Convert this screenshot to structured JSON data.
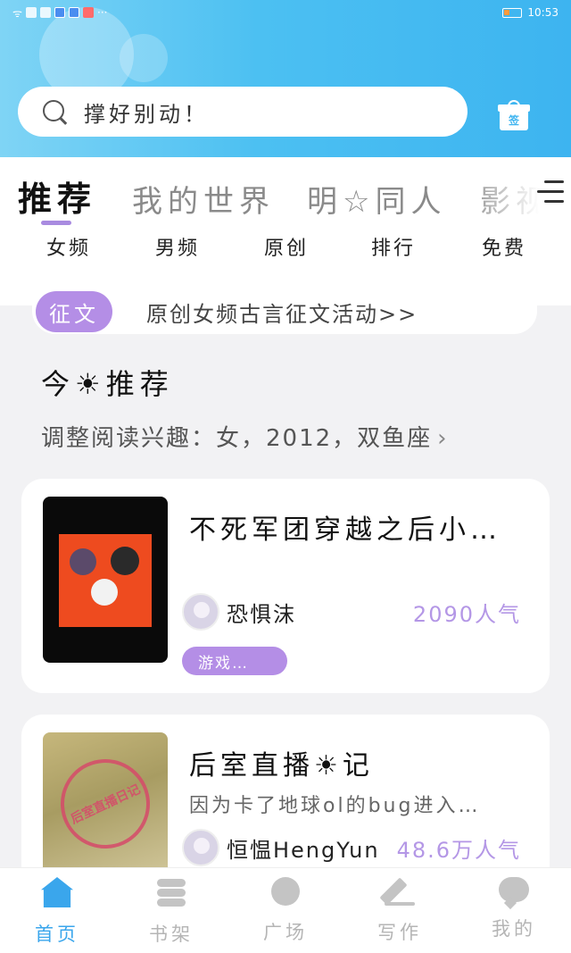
{
  "status_bar": {
    "time": "10:53"
  },
  "search": {
    "placeholder": "撑好别动！"
  },
  "gift": {
    "label": "签"
  },
  "main_tabs": [
    {
      "label": "推荐",
      "active": true
    },
    {
      "label": "我的世界",
      "active": false
    },
    {
      "label": "明☆同人",
      "active": false
    },
    {
      "label": "影视",
      "active": false
    }
  ],
  "sub_tabs": [
    {
      "label": "女频"
    },
    {
      "label": "男频"
    },
    {
      "label": "原创"
    },
    {
      "label": "排行"
    },
    {
      "label": "免费"
    }
  ],
  "notice": {
    "badge": "征文",
    "text": "原创女频古言征文活动>>"
  },
  "section": {
    "title": "今☀推荐",
    "subtitle": "调整阅读兴趣：女，2012，双鱼座"
  },
  "books": [
    {
      "title": "不死军团穿越之后小…",
      "author": "恐惧沫",
      "popularity": "2090人气",
      "tag": "游戏…"
    },
    {
      "title": "后室直播☀记",
      "description": "因为卡了地球ol的bug进入…",
      "author": "恒愠HengYun",
      "popularity": "48.6万人气",
      "cover_stamp": "后室直播日记"
    }
  ],
  "bottom_nav": [
    {
      "label": "首页",
      "icon": "home-icon",
      "active": true
    },
    {
      "label": "书架",
      "icon": "bookshelf-icon",
      "active": false
    },
    {
      "label": "广场",
      "icon": "planet-icon",
      "active": false
    },
    {
      "label": "写作",
      "icon": "pen-icon",
      "active": false
    },
    {
      "label": "我的",
      "icon": "chat-icon",
      "active": false
    }
  ],
  "colors": {
    "header_blue": "#3db4f0",
    "accent_purple": "#b48ee6",
    "nav_active": "#3aa6ec"
  }
}
